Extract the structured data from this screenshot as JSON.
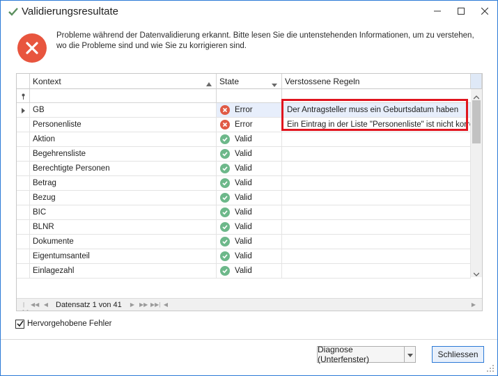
{
  "window": {
    "title": "Validierungsresultate",
    "minimize_glyph": "—",
    "maximize_glyph": "☐",
    "close_glyph": "✕"
  },
  "message": {
    "text": "Probleme während der Datenvalidierung erkannt. Bitte lesen Sie die untenstehenden Informationen, um zu verstehen, wo die Probleme sind und wie Sie zu korrigieren sind."
  },
  "grid": {
    "columns": [
      {
        "label": "Kontext"
      },
      {
        "label": "State"
      },
      {
        "label": "Verstossene Regeln"
      }
    ],
    "rows": [
      {
        "context": "GB",
        "state": "Error",
        "rule": "Der Antragsteller muss ein Geburtsdatum haben"
      },
      {
        "context": "Personenliste",
        "state": "Error",
        "rule": "Ein Eintrag in der Liste \"Personenliste\" ist nicht korrekt"
      },
      {
        "context": "Aktion",
        "state": "Valid",
        "rule": ""
      },
      {
        "context": "Begehrensliste",
        "state": "Valid",
        "rule": ""
      },
      {
        "context": "Berechtigte Personen",
        "state": "Valid",
        "rule": ""
      },
      {
        "context": "Betrag",
        "state": "Valid",
        "rule": ""
      },
      {
        "context": "Bezug",
        "state": "Valid",
        "rule": ""
      },
      {
        "context": "BIC",
        "state": "Valid",
        "rule": ""
      },
      {
        "context": "BLNR",
        "state": "Valid",
        "rule": ""
      },
      {
        "context": "Dokumente",
        "state": "Valid",
        "rule": ""
      },
      {
        "context": "Eigentumsanteil",
        "state": "Valid",
        "rule": ""
      },
      {
        "context": "Einlagezahl",
        "state": "Valid",
        "rule": ""
      }
    ],
    "navigator": {
      "record_text": "Datensatz 1 von 41"
    }
  },
  "options": {
    "highlight_checkbox_label": "Hervorgehobene Fehler",
    "highlight_checked": true
  },
  "buttons": {
    "diagnose_label": "Diagnose (Unterfenster)",
    "close_label": "Schliessen"
  },
  "colors": {
    "accent": "#2b79d6",
    "error": "#e05a45",
    "valid": "#6db88a",
    "highlight_border": "#e0141e"
  }
}
